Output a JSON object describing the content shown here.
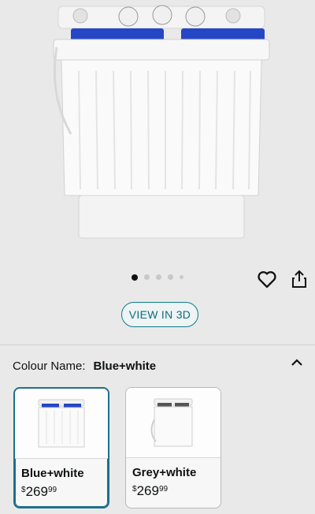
{
  "product": {
    "image_label": "Twin tub portable washing machine, blue and white"
  },
  "gallery": {
    "total_images": 5,
    "active_index": 0
  },
  "actions": {
    "favorite_icon": "heart-icon",
    "share_icon": "share-icon"
  },
  "view3d": {
    "label": "VIEW IN 3D"
  },
  "colour": {
    "label": "Colour Name:",
    "selected": "Blue+white",
    "collapse_icon": "chevron-up-icon"
  },
  "swatches": [
    {
      "name": "Blue+white",
      "currency": "$",
      "price_whole": "269",
      "price_fraction": "99",
      "accent": "#1f3fbf",
      "selected": true
    },
    {
      "name": "Grey+white",
      "currency": "$",
      "price_whole": "269",
      "price_fraction": "99",
      "accent": "#555555",
      "selected": false
    }
  ],
  "colors": {
    "accent": "#0b7c8e",
    "selected_border": "#1f6f8b",
    "lid_blue": "#1f3fbf"
  }
}
